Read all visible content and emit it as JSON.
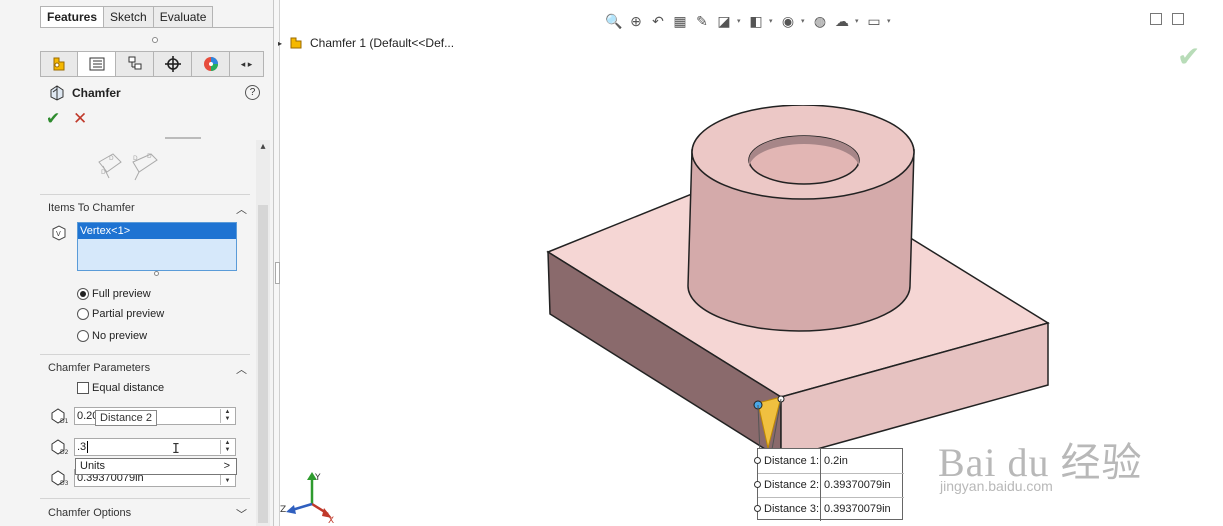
{
  "tabs": [
    {
      "label": "Features",
      "active": true
    },
    {
      "label": "Sketch",
      "active": false
    },
    {
      "label": "Evaluate",
      "active": false
    }
  ],
  "manager_icons": [
    "feature-manager-icon",
    "property-manager-icon",
    "configuration-manager-icon",
    "dimxpert-manager-icon",
    "display-manager-icon"
  ],
  "property_manager": {
    "title": "Chamfer",
    "help_icon_label": "?",
    "ok_icon": "checkmark-icon",
    "cancel_icon": "x-icon"
  },
  "items_to_chamfer": {
    "header": "Items To Chamfer",
    "selection": "Vertex<1>"
  },
  "preview": {
    "options": [
      {
        "label": "Full preview",
        "selected": true
      },
      {
        "label": "Partial preview",
        "selected": false
      },
      {
        "label": "No preview",
        "selected": false
      }
    ]
  },
  "chamfer_parameters": {
    "header": "Chamfer Parameters",
    "equal_distance_label": "Equal distance",
    "equal_distance_checked": false,
    "distance1_value": "0.20",
    "distance2_value": ".3",
    "distance3_value": "0.39370079in",
    "tooltip": "Distance 2",
    "units_popup_label": "Units",
    "units_popup_arrow": ">"
  },
  "chamfer_options": {
    "header": "Chamfer Options"
  },
  "viewport": {
    "tree_item": "Chamfer 1  (Default<<Def...",
    "callout": [
      {
        "label": "Distance 1:",
        "value": "0.2in"
      },
      {
        "label": "Distance 2:",
        "value": "0.39370079in"
      },
      {
        "label": "Distance 3:",
        "value": "0.39370079in"
      }
    ],
    "triad_labels": {
      "x": "X",
      "y": "Y",
      "z": "Z"
    },
    "model_color": "#e9c8c8",
    "highlight_color": "#f0c040"
  },
  "watermark": {
    "brand": "Bai du 经验",
    "url": "jingyan.baidu.com"
  }
}
